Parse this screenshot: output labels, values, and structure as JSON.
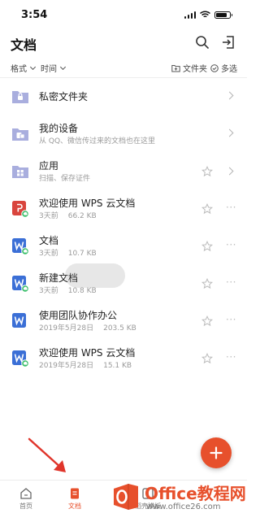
{
  "status_bar": {
    "time": "3:54"
  },
  "header": {
    "title": "文档"
  },
  "filters": {
    "format_label": "格式",
    "time_label": "时间",
    "folder_label": "文件夹",
    "multiselect_label": "多选"
  },
  "items": [
    {
      "title": "私密文件夹",
      "subtitle": "",
      "type": "folder-lock",
      "action": "chevron"
    },
    {
      "title": "我的设备",
      "subtitle": "从 QQ、微信传过来的文档也在这里",
      "type": "folder-device",
      "action": "chevron"
    },
    {
      "title": "应用",
      "subtitle": "扫描、保存证件",
      "type": "folder-apps",
      "action": "star-chevron"
    },
    {
      "title": "欢迎使用 WPS 云文档",
      "time": "3天前",
      "size": "66.2 KB",
      "type": "pdf",
      "action": "star-more"
    },
    {
      "title": "文档",
      "time": "3天前",
      "size": "10.7 KB",
      "type": "word",
      "action": "star-more"
    },
    {
      "title": "新建文档",
      "time": "3天前",
      "size": "10.8 KB",
      "type": "word",
      "action": "star-more"
    },
    {
      "title": "使用团队协作办公",
      "time": "2019年5月28日",
      "size": "203.5 KB",
      "type": "word",
      "action": "star-more"
    },
    {
      "title": "欢迎使用 WPS 云文档",
      "time": "2019年5月28日",
      "size": "15.1 KB",
      "type": "word",
      "action": "star-more"
    }
  ],
  "more_glyph": "···",
  "tabs": [
    {
      "label": "首页",
      "icon": "home-icon"
    },
    {
      "label": "文档",
      "icon": "document-icon",
      "active": true
    },
    {
      "label": "稻壳模板",
      "icon": "template-icon"
    }
  ],
  "watermark": {
    "title": "Office教程网",
    "subtitle": "www.office26.com"
  },
  "colors": {
    "accent": "#e7502c",
    "folder": "#a9aede",
    "word": "#3b6fd6",
    "pdf": "#d9453d",
    "cloud_badge": "#3bbf6a"
  }
}
